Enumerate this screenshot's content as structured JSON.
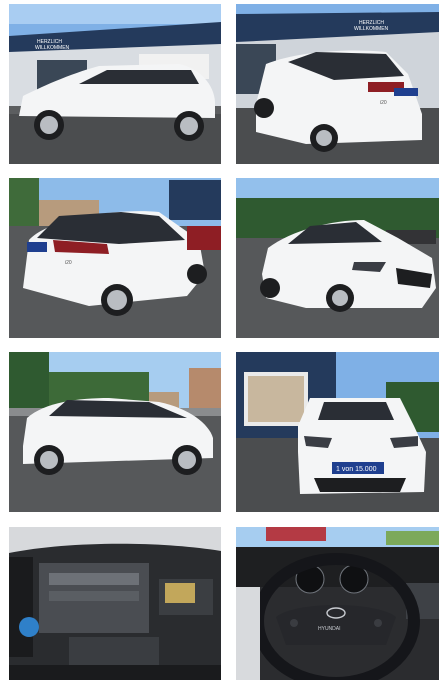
{
  "gallery": {
    "photos": [
      {
        "id": "side-left",
        "signs": [
          "HERZLICH",
          "WILLKOMMEN"
        ]
      },
      {
        "id": "rear-right",
        "signs": [
          "HERZLICH",
          "WILLKOMMEN"
        ],
        "badge": "i20"
      },
      {
        "id": "rear-left",
        "badge": "i20"
      },
      {
        "id": "front-right"
      },
      {
        "id": "side-right"
      },
      {
        "id": "front",
        "plate": "1 von 15.000"
      },
      {
        "id": "engine"
      },
      {
        "id": "interior",
        "brand": "HYUNDAI"
      }
    ]
  },
  "colors": {
    "car_body": "#f4f5f6",
    "sky": "#7fb0e6",
    "asphalt": "#4b4d4f",
    "dealer_facade": "#243a5c",
    "plate": "#1f3f8f"
  }
}
